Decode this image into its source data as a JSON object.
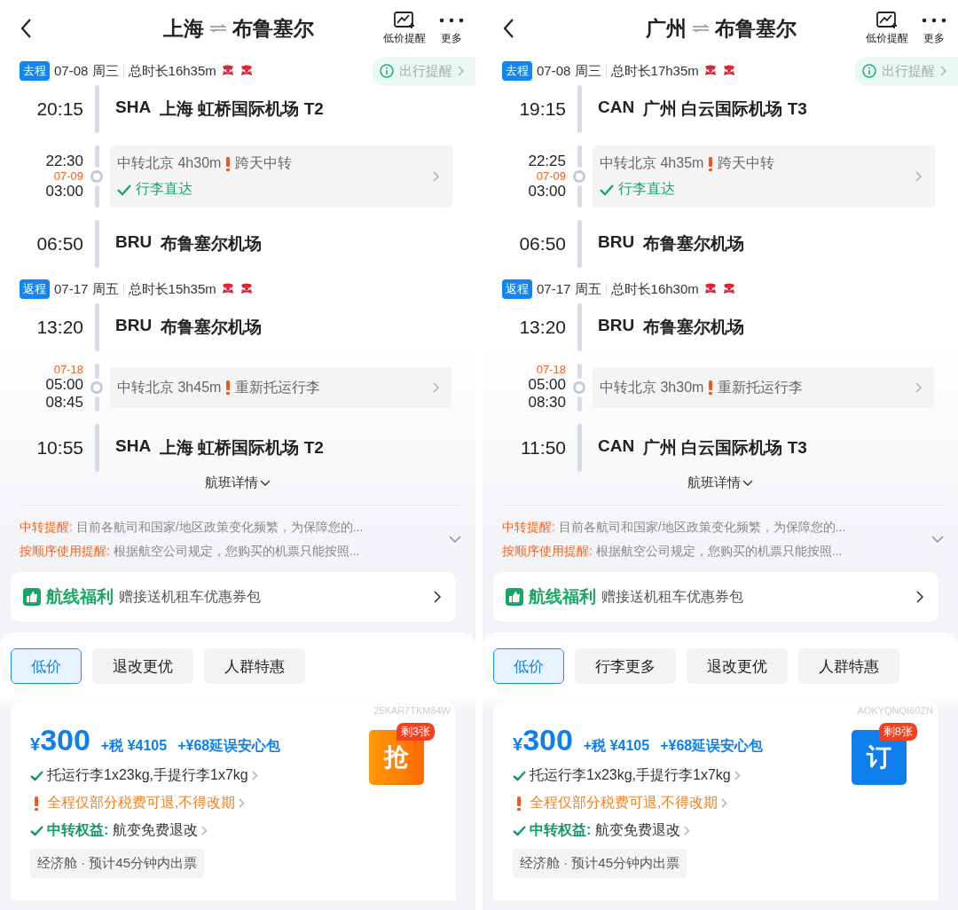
{
  "screens": [
    {
      "title": {
        "from": "上海",
        "to": "布鲁塞尔"
      },
      "header_actions": [
        {
          "kind": "price-alert",
          "label": "低价提醒"
        },
        {
          "kind": "more",
          "label": "更多"
        }
      ],
      "legs": [
        {
          "tag": "去程",
          "date": "07-08 周三",
          "duration": "总时长16h35m",
          "reminder": "出行提醒",
          "departure": {
            "time": "20:15",
            "code": "SHA",
            "airport": "上海 虹桥国际机场 T2"
          },
          "transfer": {
            "times": [
              {
                "kind": "time",
                "text": "22:30"
              },
              {
                "kind": "date",
                "text": "07-09"
              },
              {
                "kind": "time",
                "text": "03:00"
              }
            ],
            "text": "中转北京 4h30m",
            "warning": "跨天中转",
            "baggage": "行李直达"
          },
          "arrival": {
            "time": "06:50",
            "code": "BRU",
            "airport": "布鲁塞尔机场"
          }
        },
        {
          "tag": "返程",
          "date": "07-17 周五",
          "duration": "总时长15h35m",
          "departure": {
            "time": "13:20",
            "code": "BRU",
            "airport": "布鲁塞尔机场"
          },
          "transfer": {
            "times": [
              {
                "kind": "date",
                "text": "07-18"
              },
              {
                "kind": "time",
                "text": "05:00"
              },
              {
                "kind": "time",
                "text": "08:45"
              }
            ],
            "text": "中转北京 3h45m",
            "warning": "重新托运行李"
          },
          "arrival": {
            "time": "10:55",
            "code": "SHA",
            "airport": "上海 虹桥国际机场 T2"
          }
        }
      ],
      "details_link": "航班详情",
      "notices": [
        {
          "label": "中转提醒:",
          "text": "目前各航司和国家/地区政策变化频繁，为保障您的..."
        },
        {
          "label": "按顺序使用提醒:",
          "text": "根据航空公司规定，您购买的机票只能按照..."
        }
      ],
      "benefit": {
        "title": "航线福利",
        "text": "赠接送机租车优惠券包"
      },
      "tabs": [
        {
          "label": "低价",
          "selected": true
        },
        {
          "label": "退改更优",
          "selected": false
        },
        {
          "label": "人群特惠",
          "selected": false
        }
      ],
      "offer": {
        "code": "25KAR7TKM84W",
        "currency": "¥",
        "price": "300",
        "tax": "+税 ¥4105",
        "addon": "+¥68延误安心包",
        "features": [
          {
            "kind": "ok",
            "text": "托运行李1x23kg,手提行李1x7kg"
          },
          {
            "kind": "warn",
            "text": "全程仅部分税费可退,不得改期"
          },
          {
            "kind": "ok",
            "label": "中转权益:",
            "text": "航变免费退改"
          }
        ],
        "cabin": "经济舱 · 预计45分钟内出票",
        "button": {
          "kind": "urgent",
          "label": "抢",
          "badge": "剩3张"
        }
      }
    },
    {
      "title": {
        "from": "广州",
        "to": "布鲁塞尔"
      },
      "header_actions": [
        {
          "kind": "price-alert",
          "label": "低价提醒"
        },
        {
          "kind": "more",
          "label": "更多"
        }
      ],
      "legs": [
        {
          "tag": "去程",
          "date": "07-08 周三",
          "duration": "总时长17h35m",
          "reminder": "出行提醒",
          "departure": {
            "time": "19:15",
            "code": "CAN",
            "airport": "广州 白云国际机场 T3"
          },
          "transfer": {
            "times": [
              {
                "kind": "time",
                "text": "22:25"
              },
              {
                "kind": "date",
                "text": "07-09"
              },
              {
                "kind": "time",
                "text": "03:00"
              }
            ],
            "text": "中转北京 4h35m",
            "warning": "跨天中转",
            "baggage": "行李直达"
          },
          "arrival": {
            "time": "06:50",
            "code": "BRU",
            "airport": "布鲁塞尔机场"
          }
        },
        {
          "tag": "返程",
          "date": "07-17 周五",
          "duration": "总时长16h30m",
          "departure": {
            "time": "13:20",
            "code": "BRU",
            "airport": "布鲁塞尔机场"
          },
          "transfer": {
            "times": [
              {
                "kind": "date",
                "text": "07-18"
              },
              {
                "kind": "time",
                "text": "05:00"
              },
              {
                "kind": "time",
                "text": "08:30"
              }
            ],
            "text": "中转北京 3h30m",
            "warning": "重新托运行李"
          },
          "arrival": {
            "time": "11:50",
            "code": "CAN",
            "airport": "广州 白云国际机场 T3"
          }
        }
      ],
      "details_link": "航班详情",
      "notices": [
        {
          "label": "中转提醒:",
          "text": "目前各航司和国家/地区政策变化频繁，为保障您的..."
        },
        {
          "label": "按顺序使用提醒:",
          "text": "根据航空公司规定，您购买的机票只能按照..."
        }
      ],
      "benefit": {
        "title": "航线福利",
        "text": "赠接送机租车优惠券包"
      },
      "tabs": [
        {
          "label": "低价",
          "selected": true
        },
        {
          "label": "行李更多",
          "selected": false
        },
        {
          "label": "退改更优",
          "selected": false
        },
        {
          "label": "人群特惠",
          "selected": false
        }
      ],
      "offer": {
        "code": "AOKYQNQI60ZN",
        "currency": "¥",
        "price": "300",
        "tax": "+税 ¥4105",
        "addon": "+¥68延误安心包",
        "features": [
          {
            "kind": "ok",
            "text": "托运行李1x23kg,手提行李1x7kg"
          },
          {
            "kind": "warn",
            "text": "全程仅部分税费可退,不得改期"
          },
          {
            "kind": "ok",
            "label": "中转权益:",
            "text": "航变免费退改"
          }
        ],
        "cabin": "经济舱 · 预计45分钟内出票",
        "button": {
          "kind": "normal",
          "label": "订",
          "badge": "剩8张"
        }
      }
    }
  ]
}
